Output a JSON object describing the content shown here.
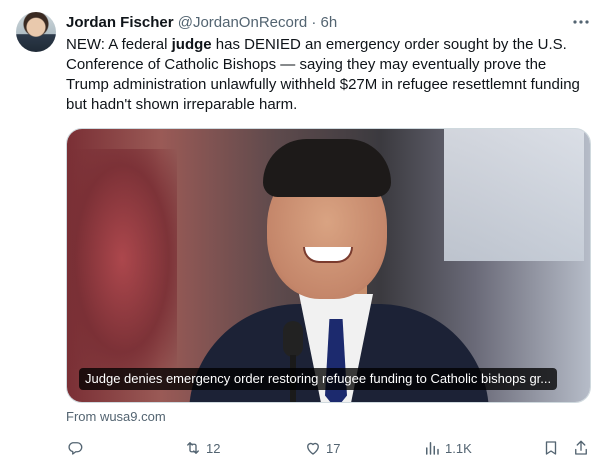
{
  "author": {
    "name": "Jordan Fischer",
    "handle": "@JordanOnRecord",
    "separator": "·",
    "time": "6h"
  },
  "tweet": {
    "text_before": "NEW: A federal ",
    "text_bold": "judge",
    "text_after": " has DENIED an emergency order sought by the U.S. Conference of Catholic Bishops  — saying they may eventually prove the Trump administration unlawfully withheld $27M in refugee resettlemnt funding but hadn't shown irreparable harm."
  },
  "card": {
    "caption": "Judge denies emergency order restoring refugee funding to Catholic bishops gr...",
    "source": "From wusa9.com"
  },
  "actions": {
    "replies": "",
    "retweets": "12",
    "likes": "17",
    "views": "1.1K"
  },
  "icons": {
    "more": "more-icon",
    "reply": "reply-icon",
    "retweet": "retweet-icon",
    "like": "like-icon",
    "views": "views-icon",
    "bookmark": "bookmark-icon",
    "share": "share-icon"
  },
  "colors": {
    "text": "#0f1419",
    "muted": "#536471",
    "border": "#cfd9de"
  }
}
